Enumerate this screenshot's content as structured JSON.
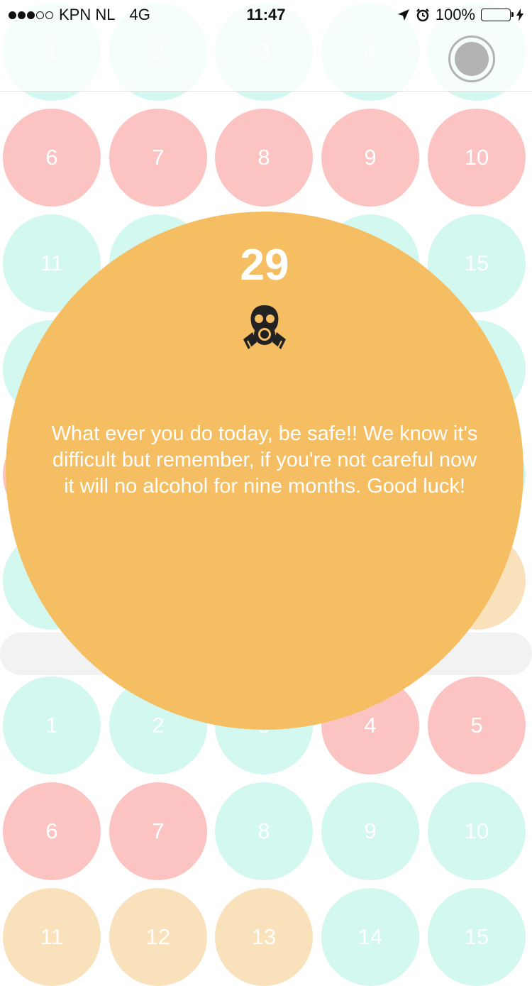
{
  "status_bar": {
    "carrier": "KPN NL",
    "network": "4G",
    "time": "11:47",
    "battery": "100%"
  },
  "grid": {
    "top_section": [
      {
        "label": "1",
        "color": "mint"
      },
      {
        "label": "2",
        "color": "mint"
      },
      {
        "label": "3",
        "color": "mint"
      },
      {
        "label": "4",
        "color": "mint"
      },
      {
        "label": "",
        "color": "mint"
      },
      {
        "label": "6",
        "color": "pink"
      },
      {
        "label": "7",
        "color": "pink"
      },
      {
        "label": "8",
        "color": "pink"
      },
      {
        "label": "9",
        "color": "pink"
      },
      {
        "label": "10",
        "color": "pink"
      },
      {
        "label": "11",
        "color": "mint"
      },
      {
        "label": "",
        "color": "mint"
      },
      {
        "label": "",
        "color": "mint"
      },
      {
        "label": "",
        "color": "mint"
      },
      {
        "label": "15",
        "color": "mint"
      },
      {
        "label": "",
        "color": "mint"
      },
      {
        "label": "",
        "color": "mint"
      },
      {
        "label": "",
        "color": "mint"
      },
      {
        "label": "",
        "color": "mint"
      },
      {
        "label": "",
        "color": "mint"
      },
      {
        "label": "",
        "color": "pink"
      },
      {
        "label": "",
        "color": "mint"
      },
      {
        "label": "",
        "color": "mint"
      },
      {
        "label": "",
        "color": "mint"
      },
      {
        "label": "",
        "color": "mint"
      },
      {
        "label": "",
        "color": "mint"
      },
      {
        "label": "",
        "color": "mint"
      },
      {
        "label": "",
        "color": "mint"
      },
      {
        "label": "",
        "color": "mint"
      },
      {
        "label": "",
        "color": "peach"
      }
    ],
    "bottom_section": [
      {
        "label": "1",
        "color": "mint"
      },
      {
        "label": "2",
        "color": "mint"
      },
      {
        "label": "3",
        "color": "mint"
      },
      {
        "label": "4",
        "color": "pink"
      },
      {
        "label": "5",
        "color": "pink"
      },
      {
        "label": "6",
        "color": "pink"
      },
      {
        "label": "7",
        "color": "pink"
      },
      {
        "label": "8",
        "color": "mint"
      },
      {
        "label": "9",
        "color": "mint"
      },
      {
        "label": "10",
        "color": "mint"
      },
      {
        "label": "11",
        "color": "peach"
      },
      {
        "label": "12",
        "color": "peach"
      },
      {
        "label": "13",
        "color": "peach"
      },
      {
        "label": "14",
        "color": "mint"
      },
      {
        "label": "15",
        "color": "mint"
      }
    ]
  },
  "popup": {
    "day": "29",
    "icon": "gas-mask-icon",
    "message": "What ever you do today, be safe!! We know it's difficult but remember, if you're not careful now it will no alcohol for nine months. Good luck!",
    "color": "#f6be62"
  },
  "colors": {
    "mint": "#d2f8ef",
    "pink": "#fbc4c2",
    "peach": "#f9e1bb",
    "popup": "#f6be62"
  }
}
